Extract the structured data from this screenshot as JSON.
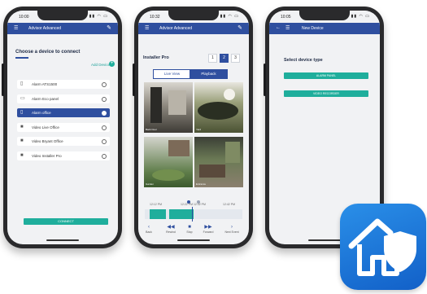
{
  "colors": {
    "primary": "#2f4f9f",
    "accent": "#1fae9c",
    "screen_bg": "#f1f2f4",
    "icon_bg": "#1a76dc"
  },
  "phone1": {
    "time": "10:00",
    "appbar_title": "Advisor Advanced",
    "heading": "Choose a device to connect",
    "add_device": "Add Device",
    "devices": [
      {
        "label": "Alarm ATS1500",
        "icon": "panel-icon",
        "selected": false
      },
      {
        "label": "Alarm Eco panel",
        "icon": "panel-icon",
        "selected": false
      },
      {
        "label": "Alarm office",
        "icon": "panel-icon",
        "selected": true
      },
      {
        "label": "Video Live Office",
        "icon": "video-icon",
        "selected": false
      },
      {
        "label": "Video Bryant Office",
        "icon": "video-icon",
        "selected": false
      },
      {
        "label": "Video Installer Pro",
        "icon": "video-icon",
        "selected": false
      }
    ],
    "connect_label": "CONNECT"
  },
  "phone2": {
    "time": "10:32",
    "appbar_title": "Advisor Advanced",
    "title": "Installer Pro",
    "pages": [
      "1",
      "2",
      "3"
    ],
    "active_page": "2",
    "tabs": [
      "Live View",
      "Playback"
    ],
    "active_tab": "Playback",
    "cameras": [
      "Back Door",
      "Yard",
      "Garden",
      "Entrance"
    ],
    "timeline_labels": [
      "12:12 PM",
      "12:22 PM  12:32 PM",
      "12:42 PM"
    ],
    "toolbar": [
      "Back",
      "Rewind",
      "Stop",
      "Forward",
      "Next Event"
    ]
  },
  "phone3": {
    "time": "10:05",
    "appbar_title": "New Device",
    "heading": "Select device type",
    "buttons": [
      "ALARM PANEL",
      "VIDEO RECORDER"
    ]
  }
}
